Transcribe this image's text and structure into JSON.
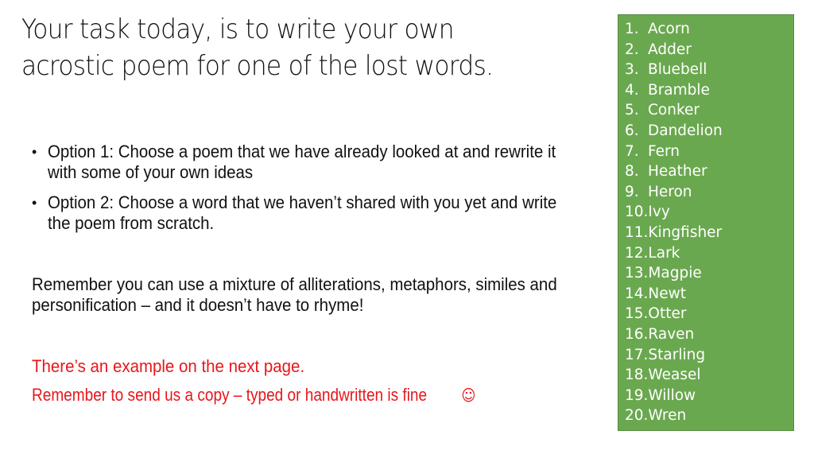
{
  "title": "Your task today, is to write your own acrostic poem for one of the lost words.",
  "options": [
    "Option 1: Choose a poem that we have already looked at and rewrite it with some of your own ideas",
    "Option 2: Choose a word that we haven’t shared with you yet and write the poem from scratch."
  ],
  "reminder": "Remember you can use a mixture of alliterations, metaphors, similes and personification – and it doesn’t have to rhyme!",
  "example_note": "There’s an example on the next page.",
  "send_note": "Remember to send us a copy – typed or handwritten is fine",
  "smiley_icon": "☺",
  "colors": {
    "box_green": "#6aa84f",
    "note_red": "#e8161b"
  },
  "words": [
    {
      "num": "1.",
      "word": "Acorn"
    },
    {
      "num": "2.",
      "word": "Adder"
    },
    {
      "num": "3.",
      "word": "Bluebell"
    },
    {
      "num": "4.",
      "word": "Bramble"
    },
    {
      "num": "5.",
      "word": "Conker"
    },
    {
      "num": "6.",
      "word": "Dandelion"
    },
    {
      "num": "7.",
      "word": "Fern"
    },
    {
      "num": "8.",
      "word": "Heather"
    },
    {
      "num": "9.",
      "word": "Heron"
    },
    {
      "num": "10.",
      "word": "Ivy"
    },
    {
      "num": "11.",
      "word": "Kingfisher"
    },
    {
      "num": "12.",
      "word": "Lark"
    },
    {
      "num": "13.",
      "word": "Magpie"
    },
    {
      "num": "14.",
      "word": "Newt"
    },
    {
      "num": "15.",
      "word": "Otter"
    },
    {
      "num": "16.",
      "word": "Raven"
    },
    {
      "num": "17.",
      "word": "Starling"
    },
    {
      "num": "18.",
      "word": "Weasel"
    },
    {
      "num": "19.",
      "word": "Willow"
    },
    {
      "num": "20.",
      "word": "Wren"
    }
  ]
}
